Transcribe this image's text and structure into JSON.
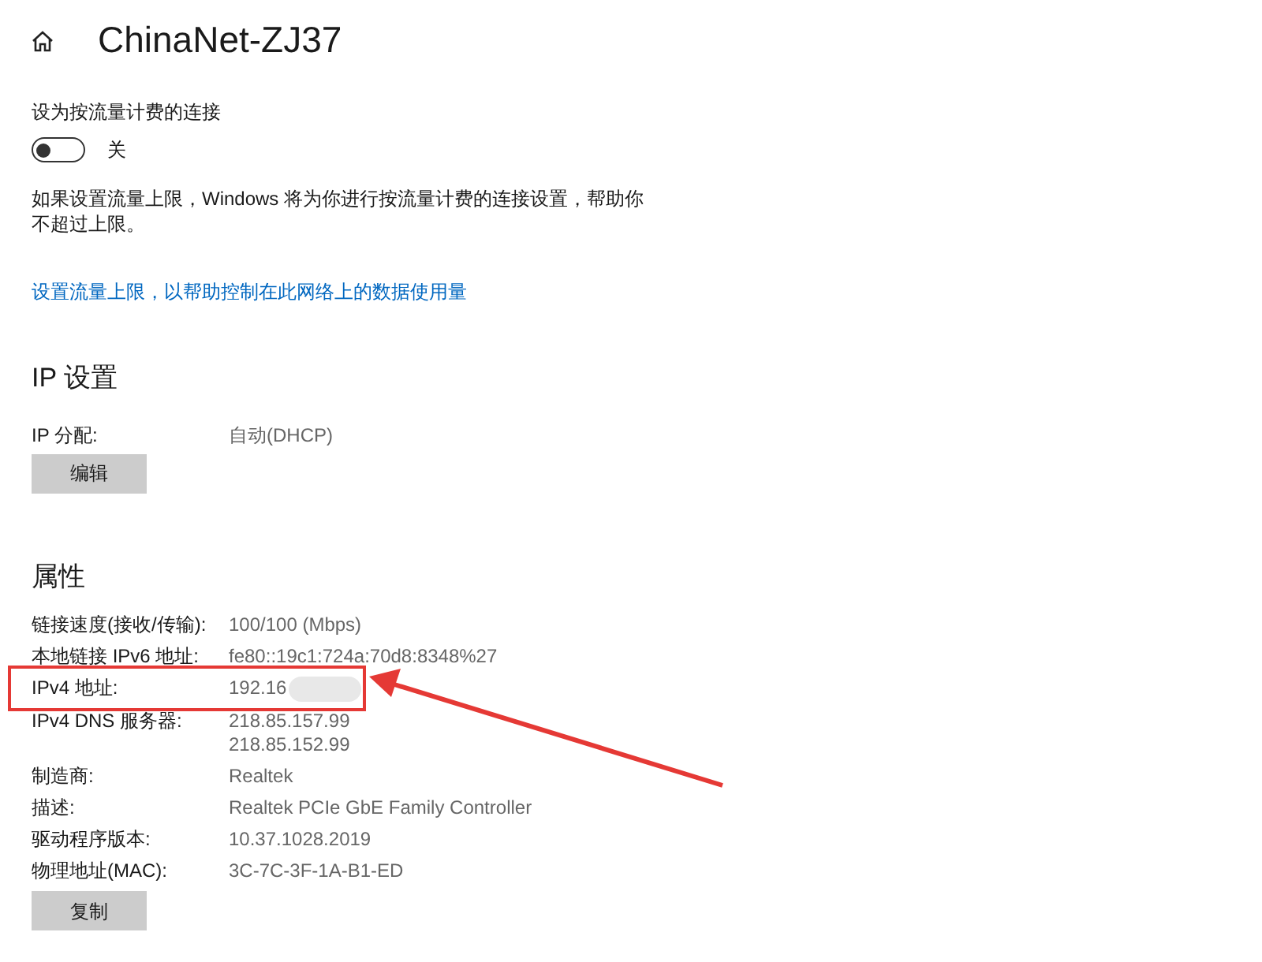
{
  "header": {
    "title": "ChinaNet-ZJ37"
  },
  "metered": {
    "label": "设为按流量计费的连接",
    "on": false,
    "state_text": "关",
    "description": "如果设置流量上限，Windows 将为你进行按流量计费的连接设置，帮助你不超过上限。",
    "link": "设置流量上限，以帮助控制在此网络上的数据使用量"
  },
  "ip_settings": {
    "heading": "IP 设置",
    "rows": [
      {
        "label": "IP 分配:",
        "values": [
          "自动(DHCP)"
        ]
      }
    ],
    "button": "编辑"
  },
  "properties": {
    "heading": "属性",
    "rows": [
      {
        "label": "链接速度(接收/传输):",
        "values": [
          "100/100 (Mbps)"
        ],
        "highlighted": false,
        "blurred": false
      },
      {
        "label": "本地链接 IPv6 地址:",
        "values": [
          "fe80::19c1:724a:70d8:8348%27"
        ],
        "highlighted": false,
        "blurred": false
      },
      {
        "label": "IPv4 地址:",
        "values": [
          "192.16"
        ],
        "highlighted": true,
        "blurred": true
      },
      {
        "label": "IPv4 DNS 服务器:",
        "values": [
          "218.85.157.99",
          "218.85.152.99"
        ],
        "highlighted": false,
        "blurred": false
      },
      {
        "label": "制造商:",
        "values": [
          "Realtek"
        ],
        "highlighted": false,
        "blurred": false
      },
      {
        "label": "描述:",
        "values": [
          "Realtek PCIe GbE Family Controller"
        ],
        "highlighted": false,
        "blurred": false
      },
      {
        "label": "驱动程序版本:",
        "values": [
          "10.37.1028.2019"
        ],
        "highlighted": false,
        "blurred": false
      },
      {
        "label": "物理地址(MAC):",
        "values": [
          "3C-7C-3F-1A-B1-ED"
        ],
        "highlighted": false,
        "blurred": false
      }
    ],
    "button": "复制"
  }
}
